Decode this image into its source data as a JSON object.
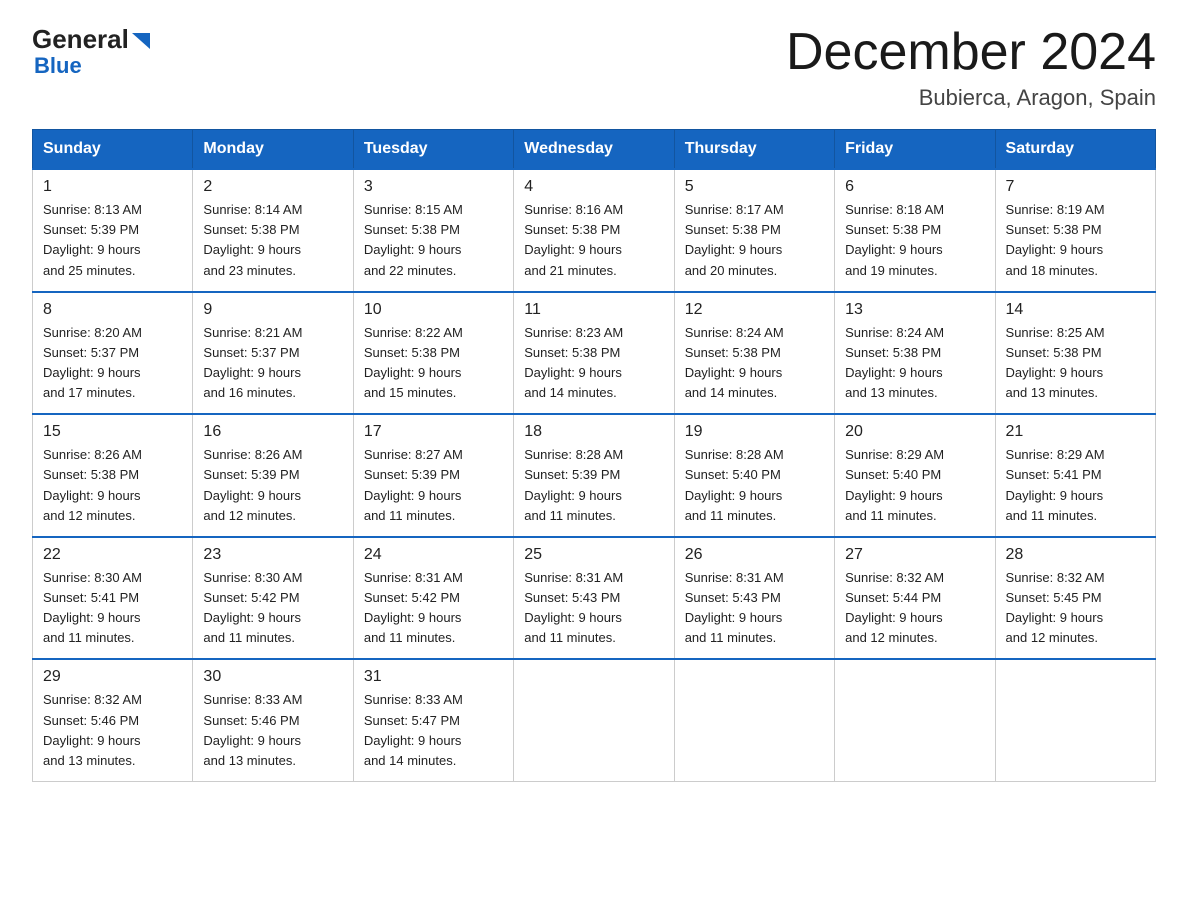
{
  "logo": {
    "line1": "General",
    "line2": "Blue"
  },
  "header": {
    "month_title": "December 2024",
    "location": "Bubierca, Aragon, Spain"
  },
  "weekdays": [
    "Sunday",
    "Monday",
    "Tuesday",
    "Wednesday",
    "Thursday",
    "Friday",
    "Saturday"
  ],
  "weeks": [
    [
      {
        "day": "1",
        "sunrise": "8:13 AM",
        "sunset": "5:39 PM",
        "daylight": "9 hours and 25 minutes."
      },
      {
        "day": "2",
        "sunrise": "8:14 AM",
        "sunset": "5:38 PM",
        "daylight": "9 hours and 23 minutes."
      },
      {
        "day": "3",
        "sunrise": "8:15 AM",
        "sunset": "5:38 PM",
        "daylight": "9 hours and 22 minutes."
      },
      {
        "day": "4",
        "sunrise": "8:16 AM",
        "sunset": "5:38 PM",
        "daylight": "9 hours and 21 minutes."
      },
      {
        "day": "5",
        "sunrise": "8:17 AM",
        "sunset": "5:38 PM",
        "daylight": "9 hours and 20 minutes."
      },
      {
        "day": "6",
        "sunrise": "8:18 AM",
        "sunset": "5:38 PM",
        "daylight": "9 hours and 19 minutes."
      },
      {
        "day": "7",
        "sunrise": "8:19 AM",
        "sunset": "5:38 PM",
        "daylight": "9 hours and 18 minutes."
      }
    ],
    [
      {
        "day": "8",
        "sunrise": "8:20 AM",
        "sunset": "5:37 PM",
        "daylight": "9 hours and 17 minutes."
      },
      {
        "day": "9",
        "sunrise": "8:21 AM",
        "sunset": "5:37 PM",
        "daylight": "9 hours and 16 minutes."
      },
      {
        "day": "10",
        "sunrise": "8:22 AM",
        "sunset": "5:38 PM",
        "daylight": "9 hours and 15 minutes."
      },
      {
        "day": "11",
        "sunrise": "8:23 AM",
        "sunset": "5:38 PM",
        "daylight": "9 hours and 14 minutes."
      },
      {
        "day": "12",
        "sunrise": "8:24 AM",
        "sunset": "5:38 PM",
        "daylight": "9 hours and 14 minutes."
      },
      {
        "day": "13",
        "sunrise": "8:24 AM",
        "sunset": "5:38 PM",
        "daylight": "9 hours and 13 minutes."
      },
      {
        "day": "14",
        "sunrise": "8:25 AM",
        "sunset": "5:38 PM",
        "daylight": "9 hours and 13 minutes."
      }
    ],
    [
      {
        "day": "15",
        "sunrise": "8:26 AM",
        "sunset": "5:38 PM",
        "daylight": "9 hours and 12 minutes."
      },
      {
        "day": "16",
        "sunrise": "8:26 AM",
        "sunset": "5:39 PM",
        "daylight": "9 hours and 12 minutes."
      },
      {
        "day": "17",
        "sunrise": "8:27 AM",
        "sunset": "5:39 PM",
        "daylight": "9 hours and 11 minutes."
      },
      {
        "day": "18",
        "sunrise": "8:28 AM",
        "sunset": "5:39 PM",
        "daylight": "9 hours and 11 minutes."
      },
      {
        "day": "19",
        "sunrise": "8:28 AM",
        "sunset": "5:40 PM",
        "daylight": "9 hours and 11 minutes."
      },
      {
        "day": "20",
        "sunrise": "8:29 AM",
        "sunset": "5:40 PM",
        "daylight": "9 hours and 11 minutes."
      },
      {
        "day": "21",
        "sunrise": "8:29 AM",
        "sunset": "5:41 PM",
        "daylight": "9 hours and 11 minutes."
      }
    ],
    [
      {
        "day": "22",
        "sunrise": "8:30 AM",
        "sunset": "5:41 PM",
        "daylight": "9 hours and 11 minutes."
      },
      {
        "day": "23",
        "sunrise": "8:30 AM",
        "sunset": "5:42 PM",
        "daylight": "9 hours and 11 minutes."
      },
      {
        "day": "24",
        "sunrise": "8:31 AM",
        "sunset": "5:42 PM",
        "daylight": "9 hours and 11 minutes."
      },
      {
        "day": "25",
        "sunrise": "8:31 AM",
        "sunset": "5:43 PM",
        "daylight": "9 hours and 11 minutes."
      },
      {
        "day": "26",
        "sunrise": "8:31 AM",
        "sunset": "5:43 PM",
        "daylight": "9 hours and 11 minutes."
      },
      {
        "day": "27",
        "sunrise": "8:32 AM",
        "sunset": "5:44 PM",
        "daylight": "9 hours and 12 minutes."
      },
      {
        "day": "28",
        "sunrise": "8:32 AM",
        "sunset": "5:45 PM",
        "daylight": "9 hours and 12 minutes."
      }
    ],
    [
      {
        "day": "29",
        "sunrise": "8:32 AM",
        "sunset": "5:46 PM",
        "daylight": "9 hours and 13 minutes."
      },
      {
        "day": "30",
        "sunrise": "8:33 AM",
        "sunset": "5:46 PM",
        "daylight": "9 hours and 13 minutes."
      },
      {
        "day": "31",
        "sunrise": "8:33 AM",
        "sunset": "5:47 PM",
        "daylight": "9 hours and 14 minutes."
      },
      null,
      null,
      null,
      null
    ]
  ]
}
